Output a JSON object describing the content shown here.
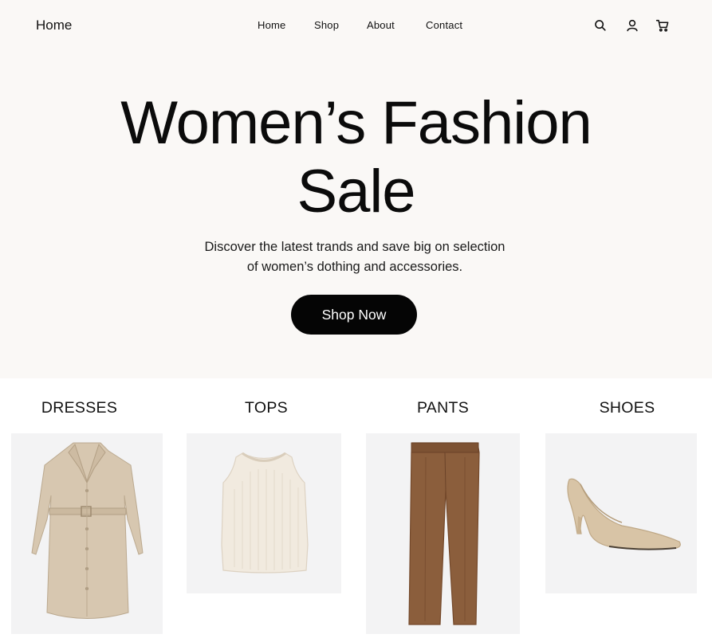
{
  "header": {
    "brand": "Home",
    "nav": [
      "Home",
      "Shop",
      "About",
      "Contact"
    ],
    "icons": [
      "search-icon",
      "user-icon",
      "cart-icon"
    ]
  },
  "hero": {
    "title_line1": "Women’s Fashion",
    "title_line2": "Sale",
    "subtitle_line1": "Discover the latest trands and save big on selection",
    "subtitle_line2": "of women’s dothing and accessories.",
    "cta_label": "Shop Now"
  },
  "categories": [
    {
      "label": "DRESSES",
      "image": "beige-trench-dress"
    },
    {
      "label": "TOPS",
      "image": "cream-knit-tank"
    },
    {
      "label": "PANTS",
      "image": "brown-trousers"
    },
    {
      "label": "SHOES",
      "image": "nude-pump-heel"
    }
  ],
  "colors": {
    "hero_bg": "#faf8f6",
    "button_bg": "#050505",
    "button_text": "#ffffff",
    "card_bg": "#f3f3f4"
  }
}
